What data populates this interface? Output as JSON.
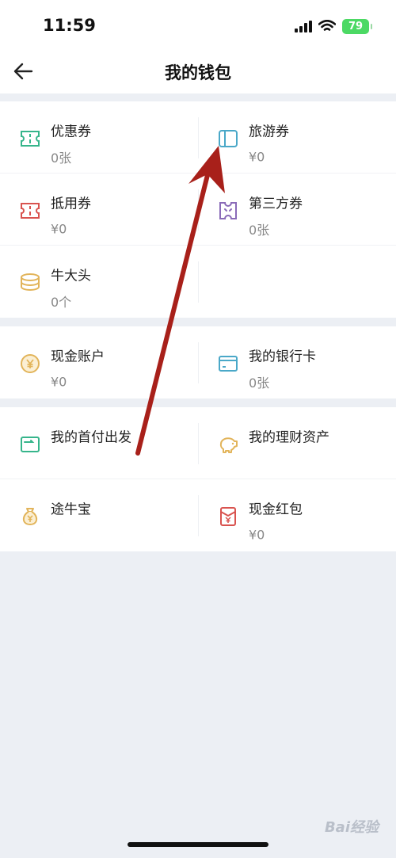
{
  "status_bar": {
    "time": "11:59",
    "battery": "79"
  },
  "header": {
    "title": "我的钱包"
  },
  "sections": [
    {
      "rows": [
        {
          "left": {
            "label": "优惠券",
            "value": "0张",
            "icon": "coupon-icon",
            "color": "#36b58b"
          },
          "right": {
            "label": "旅游券",
            "value": "¥0",
            "icon": "travel-voucher-icon",
            "color": "#4aa8c8"
          }
        },
        {
          "left": {
            "label": "抵用券",
            "value": "¥0",
            "icon": "deduction-voucher-icon",
            "color": "#d9534f"
          },
          "right": {
            "label": "第三方券",
            "value": "0张",
            "icon": "third-party-voucher-icon",
            "color": "#8a6bb8"
          }
        },
        {
          "left": {
            "label": "牛大头",
            "value": "0个",
            "icon": "coins-icon",
            "color": "#e2b45a"
          }
        }
      ]
    },
    {
      "rows": [
        {
          "left": {
            "label": "现金账户",
            "value": "¥0",
            "icon": "yen-coin-icon",
            "color": "#e2b45a"
          },
          "right": {
            "label": "我的银行卡",
            "value": "0张",
            "icon": "bank-card-icon",
            "color": "#4aa8c8"
          }
        }
      ]
    },
    {
      "rows": [
        {
          "left": {
            "label": "我的首付出发",
            "icon": "down-payment-icon",
            "color": "#36b58b"
          },
          "right": {
            "label": "我的理财资产",
            "icon": "piggy-bank-icon",
            "color": "#e2b45a"
          }
        },
        {
          "left": {
            "label": "途牛宝",
            "icon": "money-bag-icon",
            "color": "#e2b45a"
          },
          "right": {
            "label": "现金红包",
            "value": "¥0",
            "icon": "red-packet-icon",
            "color": "#d9534f"
          }
        }
      ]
    }
  ],
  "watermark": "Bai经验"
}
